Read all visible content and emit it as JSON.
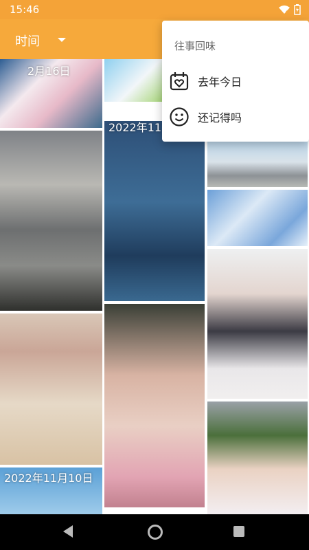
{
  "status": {
    "time": "15:46",
    "wifi_icon": "wifi-off-icon",
    "battery_icon": "battery-charging-icon"
  },
  "appbar": {
    "title": "时间",
    "caret_icon": "chevron-down-icon"
  },
  "grid": {
    "tile_dates": [
      "2月16日",
      "2022年11",
      "2022年11月10日"
    ]
  },
  "menu": {
    "header": "往事回味",
    "items": [
      {
        "label": "去年今日",
        "icon": "calendar-heart-icon"
      },
      {
        "label": "还记得吗",
        "icon": "smile-icon"
      }
    ]
  },
  "navbar": {
    "back_icon": "back-icon",
    "home_icon": "home-icon",
    "recent_icon": "recent-apps-icon"
  }
}
